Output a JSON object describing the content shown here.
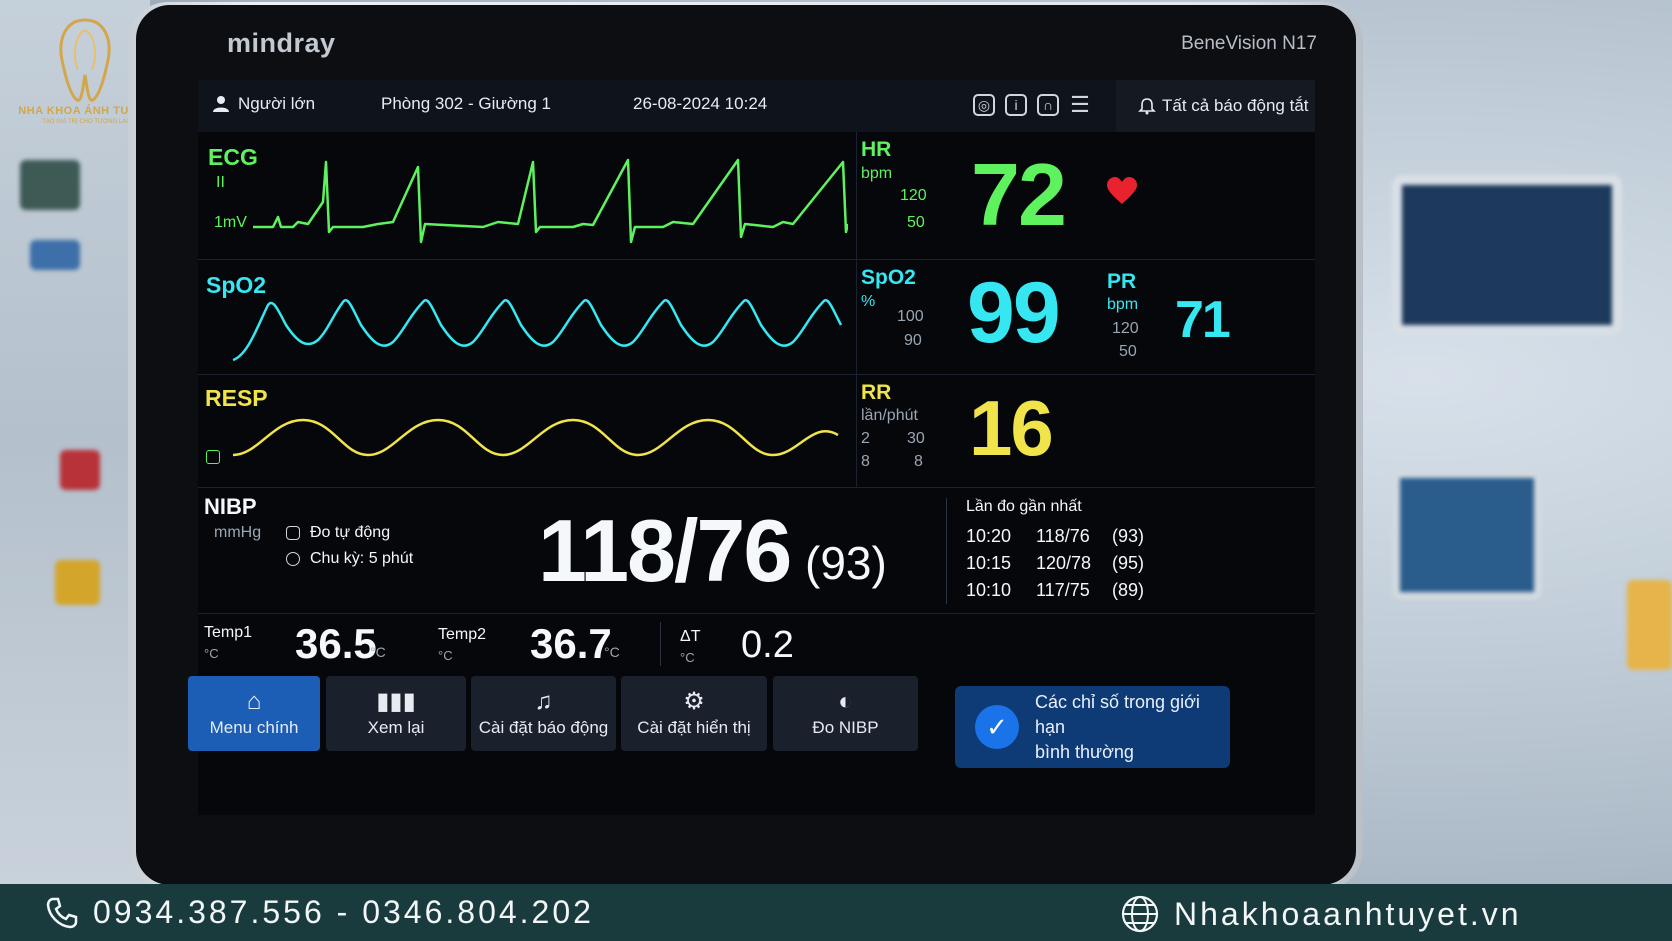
{
  "watermark": {
    "logo_name": "NHA KHOA ÁNH TUYẾT",
    "logo_slogan": "TẠO GIÁ TRỊ CHO TƯƠNG LAI",
    "phone": "0934.387.556 - 0346.804.202",
    "website": "Nhakhoaanhtuyet.vn",
    "phone_icon": "phone-icon",
    "web_icon": "globe-icon"
  },
  "device": {
    "brand": "mindray",
    "model": "BeneVision N17"
  },
  "topbar": {
    "patient_type": "Người lớn",
    "room": "Phòng 302 - Giường 1",
    "datetime": "26-08-2024 10:24",
    "alarm_status": "Tất cả báo động tắt",
    "icons": [
      "record-icon",
      "info-icon",
      "headset-icon",
      "menu-icon"
    ]
  },
  "ecg": {
    "label": "ECG",
    "lead": "II",
    "scale": "1mV",
    "color": "#5ef25e",
    "hr_label": "HR",
    "hr_unit": "bpm",
    "hr_high": "120",
    "hr_low": "50",
    "hr_value": "72",
    "heart_icon": "heart-icon"
  },
  "spo2": {
    "label": "SpO2",
    "color": "#36e6f0",
    "param_label": "SpO2",
    "unit": "%",
    "high": "100",
    "low": "90",
    "value": "99",
    "pr_label": "PR",
    "pr_unit": "bpm",
    "pr_high": "120",
    "pr_low": "50",
    "pr_value": "71"
  },
  "resp": {
    "label": "RESP",
    "color": "#f1e44a",
    "param_label": "RR",
    "unit": "lần/phút",
    "high_prefix": "2",
    "high": "30",
    "low_prefix": "8",
    "low": "8",
    "value": "16"
  },
  "nibp": {
    "label": "NIBP",
    "unit": "mmHg",
    "mode": "Đo tự động",
    "cycle": "Chu kỳ: 5 phút",
    "value": "118/76",
    "mean": "(93)",
    "history_title": "Lần đo gần nhất",
    "history": [
      {
        "time": "10:20",
        "bp": "118/76",
        "mean": "(93)"
      },
      {
        "time": "10:15",
        "bp": "120/78",
        "mean": "(95)"
      },
      {
        "time": "10:10",
        "bp": "117/75",
        "mean": "(89)"
      }
    ]
  },
  "temp": {
    "t1_label": "Temp1",
    "t1_unit": "°C",
    "t1_value": "36.5",
    "t1_suffix": "°C",
    "t2_label": "Temp2",
    "t2_unit": "°C",
    "t2_value": "36.7",
    "t2_suffix": "°C",
    "dt_label": "ΔT",
    "dt_unit": "°C",
    "dt_value": "0.2"
  },
  "nav": {
    "main_menu": "Menu chính",
    "review": "Xem lại",
    "alarm_settings": "Cài đặt báo động",
    "display_settings": "Cài đặt hiển thị",
    "nibp_measure": "Đo NIBP",
    "status_line1": "Các chỉ số trong giới hạn",
    "status_line2": "bình thường"
  }
}
